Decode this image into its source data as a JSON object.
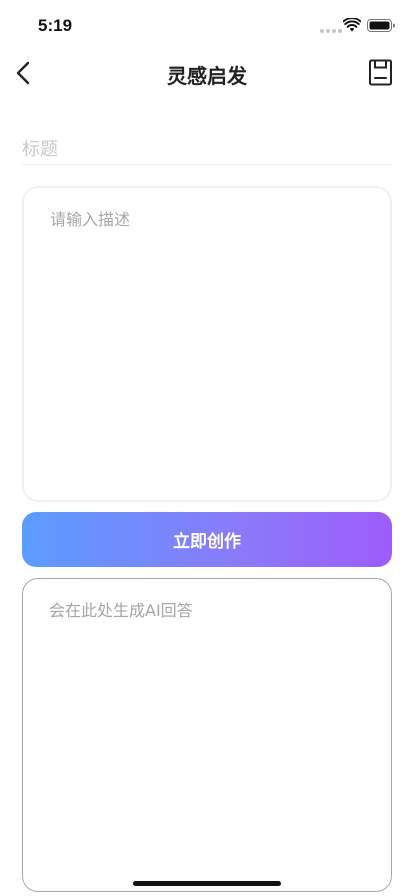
{
  "status_bar": {
    "time": "5:19"
  },
  "nav": {
    "title": "灵感启发",
    "back_icon": "chevron-left-icon",
    "save_icon": "save-icon"
  },
  "form": {
    "title_placeholder": "标题",
    "title_value": "",
    "description_placeholder": "请输入描述",
    "description_value": ""
  },
  "actions": {
    "create_label": "立即创作"
  },
  "answer": {
    "placeholder": "会在此处生成AI回答"
  },
  "colors": {
    "gradient_start": "#5a9cff",
    "gradient_end": "#9d5cfb",
    "placeholder_text": "#a6a6a6"
  }
}
